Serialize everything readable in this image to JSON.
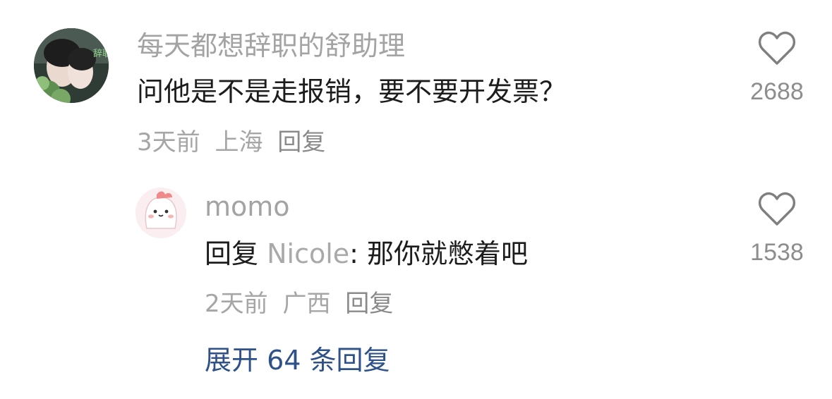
{
  "comment": {
    "username": "每天都想辞职的舒助理",
    "text": "问他是不是走报销，要不要开发票？",
    "time": "3天前",
    "location": "上海",
    "reply_label": "回复",
    "likes": "2688",
    "avatar_text": "辞职"
  },
  "reply": {
    "username": "momo",
    "prefix": "回复",
    "mention": "Nicole",
    "text": ": 那你就憋着吧",
    "time": "2天前",
    "location": "广西",
    "reply_label": "回复",
    "likes": "1538"
  },
  "expand_label": "展开 64 条回复",
  "colors": {
    "link_blue": "#2e5189",
    "muted_gray": "#a3a3a3",
    "text_dark": "#1c1c1c"
  },
  "icons": {
    "like": "heart-outline-icon"
  }
}
